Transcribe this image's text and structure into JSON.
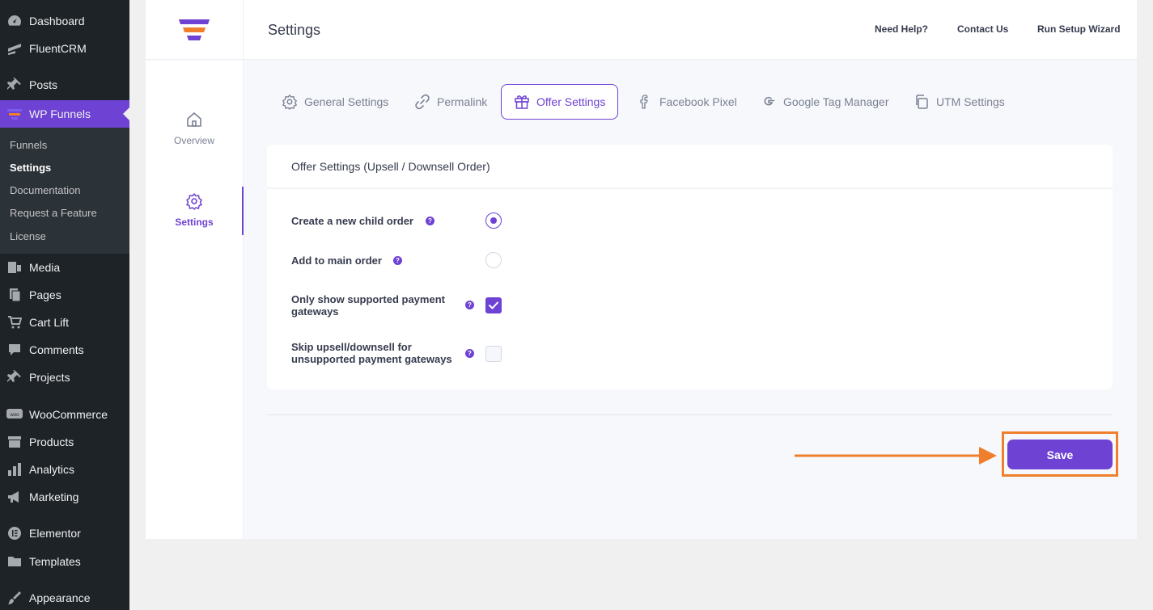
{
  "wp_menu": {
    "items": [
      {
        "label": "Dashboard",
        "icon": "dashboard-icon"
      },
      {
        "label": "FluentCRM",
        "icon": "fluentcrm-icon"
      },
      {
        "label": "Posts",
        "icon": "pin-icon"
      },
      {
        "label": "WP Funnels",
        "icon": "funnel-icon"
      },
      {
        "label": "Media",
        "icon": "media-icon"
      },
      {
        "label": "Pages",
        "icon": "pages-icon"
      },
      {
        "label": "Cart Lift",
        "icon": "cart-icon"
      },
      {
        "label": "Comments",
        "icon": "comment-icon"
      },
      {
        "label": "Projects",
        "icon": "pin-icon"
      },
      {
        "label": "WooCommerce",
        "icon": "woo-icon"
      },
      {
        "label": "Products",
        "icon": "archive-icon"
      },
      {
        "label": "Analytics",
        "icon": "bar-chart-icon"
      },
      {
        "label": "Marketing",
        "icon": "megaphone-icon"
      },
      {
        "label": "Elementor",
        "icon": "elementor-icon"
      },
      {
        "label": "Templates",
        "icon": "folder-icon"
      },
      {
        "label": "Appearance",
        "icon": "brush-icon"
      }
    ],
    "submenu": [
      "Funnels",
      "Settings",
      "Documentation",
      "Request a Feature",
      "License"
    ]
  },
  "header": {
    "title": "Settings",
    "links": [
      "Need Help?",
      "Contact Us",
      "Run Setup Wizard"
    ]
  },
  "left_nav": {
    "items": [
      "Overview",
      "Settings"
    ]
  },
  "tabs": [
    "General Settings",
    "Permalink",
    "Offer Settings",
    "Facebook Pixel",
    "Google Tag Manager",
    "UTM Settings"
  ],
  "card": {
    "title": "Offer Settings (Upsell / Downsell Order)",
    "options": [
      {
        "label": "Create a new child order",
        "control": "radio",
        "checked": true
      },
      {
        "label": "Add to main order",
        "control": "radio",
        "checked": false
      },
      {
        "label": "Only show supported payment gateways",
        "control": "checkbox",
        "checked": true
      },
      {
        "label": "Skip upsell/downsell for unsupported payment gateways",
        "control": "checkbox",
        "checked": false
      }
    ]
  },
  "help_glyph": "?",
  "save_label": "Save",
  "colors": {
    "accent": "#6e42d3",
    "highlight": "#f07f2d",
    "wp_sidebar": "#1d2327"
  }
}
